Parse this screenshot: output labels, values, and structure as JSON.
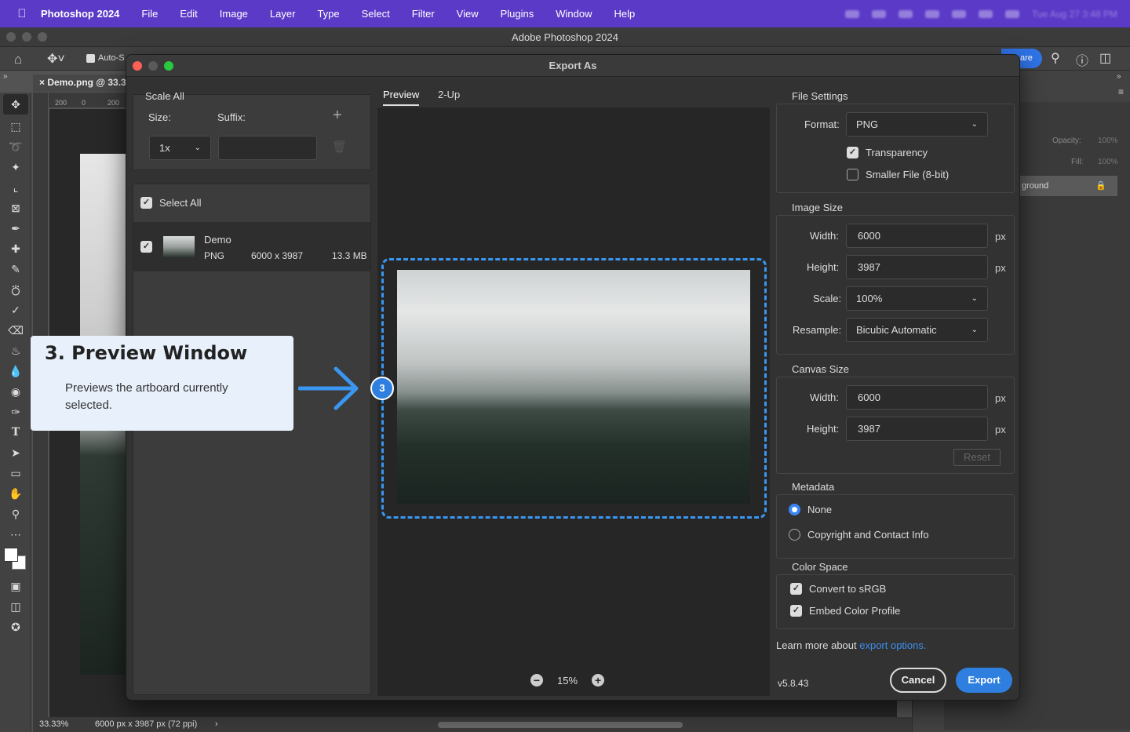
{
  "menubar": {
    "app": "Photoshop 2024",
    "items": [
      "File",
      "Edit",
      "Image",
      "Layer",
      "Type",
      "Select",
      "Filter",
      "View",
      "Plugins",
      "Window",
      "Help"
    ],
    "clock": "Tue Aug 27  3:48 PM"
  },
  "window": {
    "title": "Adobe Photoshop 2024"
  },
  "options": {
    "auto_select": "Auto-S",
    "share": "are"
  },
  "document": {
    "tab": "Demo.png @ 33.3",
    "ruler_marks": [
      "200",
      "0",
      "200"
    ]
  },
  "status": {
    "zoom": "33.33%",
    "dims": "6000 px x 3987 px (72 ppi)"
  },
  "layers": {
    "opacity_label": "Opacity:",
    "opacity": "100%",
    "fill_label": "Fill:",
    "fill": "100%",
    "bg_layer": "ground"
  },
  "dialog": {
    "title": "Export As",
    "scale_all": {
      "heading": "Scale All",
      "size_label": "Size:",
      "suffix_label": "Suffix:",
      "size_value": "1x",
      "suffix_value": ""
    },
    "select_all": "Select All",
    "asset": {
      "name": "Demo",
      "format": "PNG",
      "dims": "6000 x 3987",
      "size": "13.3 MB"
    },
    "preview_tabs": [
      "Preview",
      "2-Up"
    ],
    "zoom": "15%",
    "file_settings": {
      "heading": "File Settings",
      "format_label": "Format:",
      "format": "PNG",
      "transparency": "Transparency",
      "smaller_file": "Smaller File (8-bit)"
    },
    "image_size": {
      "heading": "Image Size",
      "width_label": "Width:",
      "width": "6000",
      "height_label": "Height:",
      "height": "3987",
      "scale_label": "Scale:",
      "scale": "100%",
      "resample_label": "Resample:",
      "resample": "Bicubic Automatic",
      "unit": "px"
    },
    "canvas_size": {
      "heading": "Canvas Size",
      "width_label": "Width:",
      "width": "6000",
      "height_label": "Height:",
      "height": "3987",
      "unit": "px",
      "reset": "Reset"
    },
    "metadata": {
      "heading": "Metadata",
      "none": "None",
      "copyright": "Copyright and Contact Info"
    },
    "color_space": {
      "heading": "Color Space",
      "srgb": "Convert to sRGB",
      "embed": "Embed Color Profile"
    },
    "learn_more": "Learn more about ",
    "learn_link": "export options.",
    "version": "v5.8.43",
    "cancel": "Cancel",
    "export": "Export"
  },
  "callout": {
    "badge": "3",
    "title": "3. Preview Window",
    "body": "Previews the artboard currently selected."
  },
  "colors": {
    "menubar": "#5b3ac8",
    "accent": "#2f7fe0",
    "callout_bg": "#e8f0fb"
  }
}
